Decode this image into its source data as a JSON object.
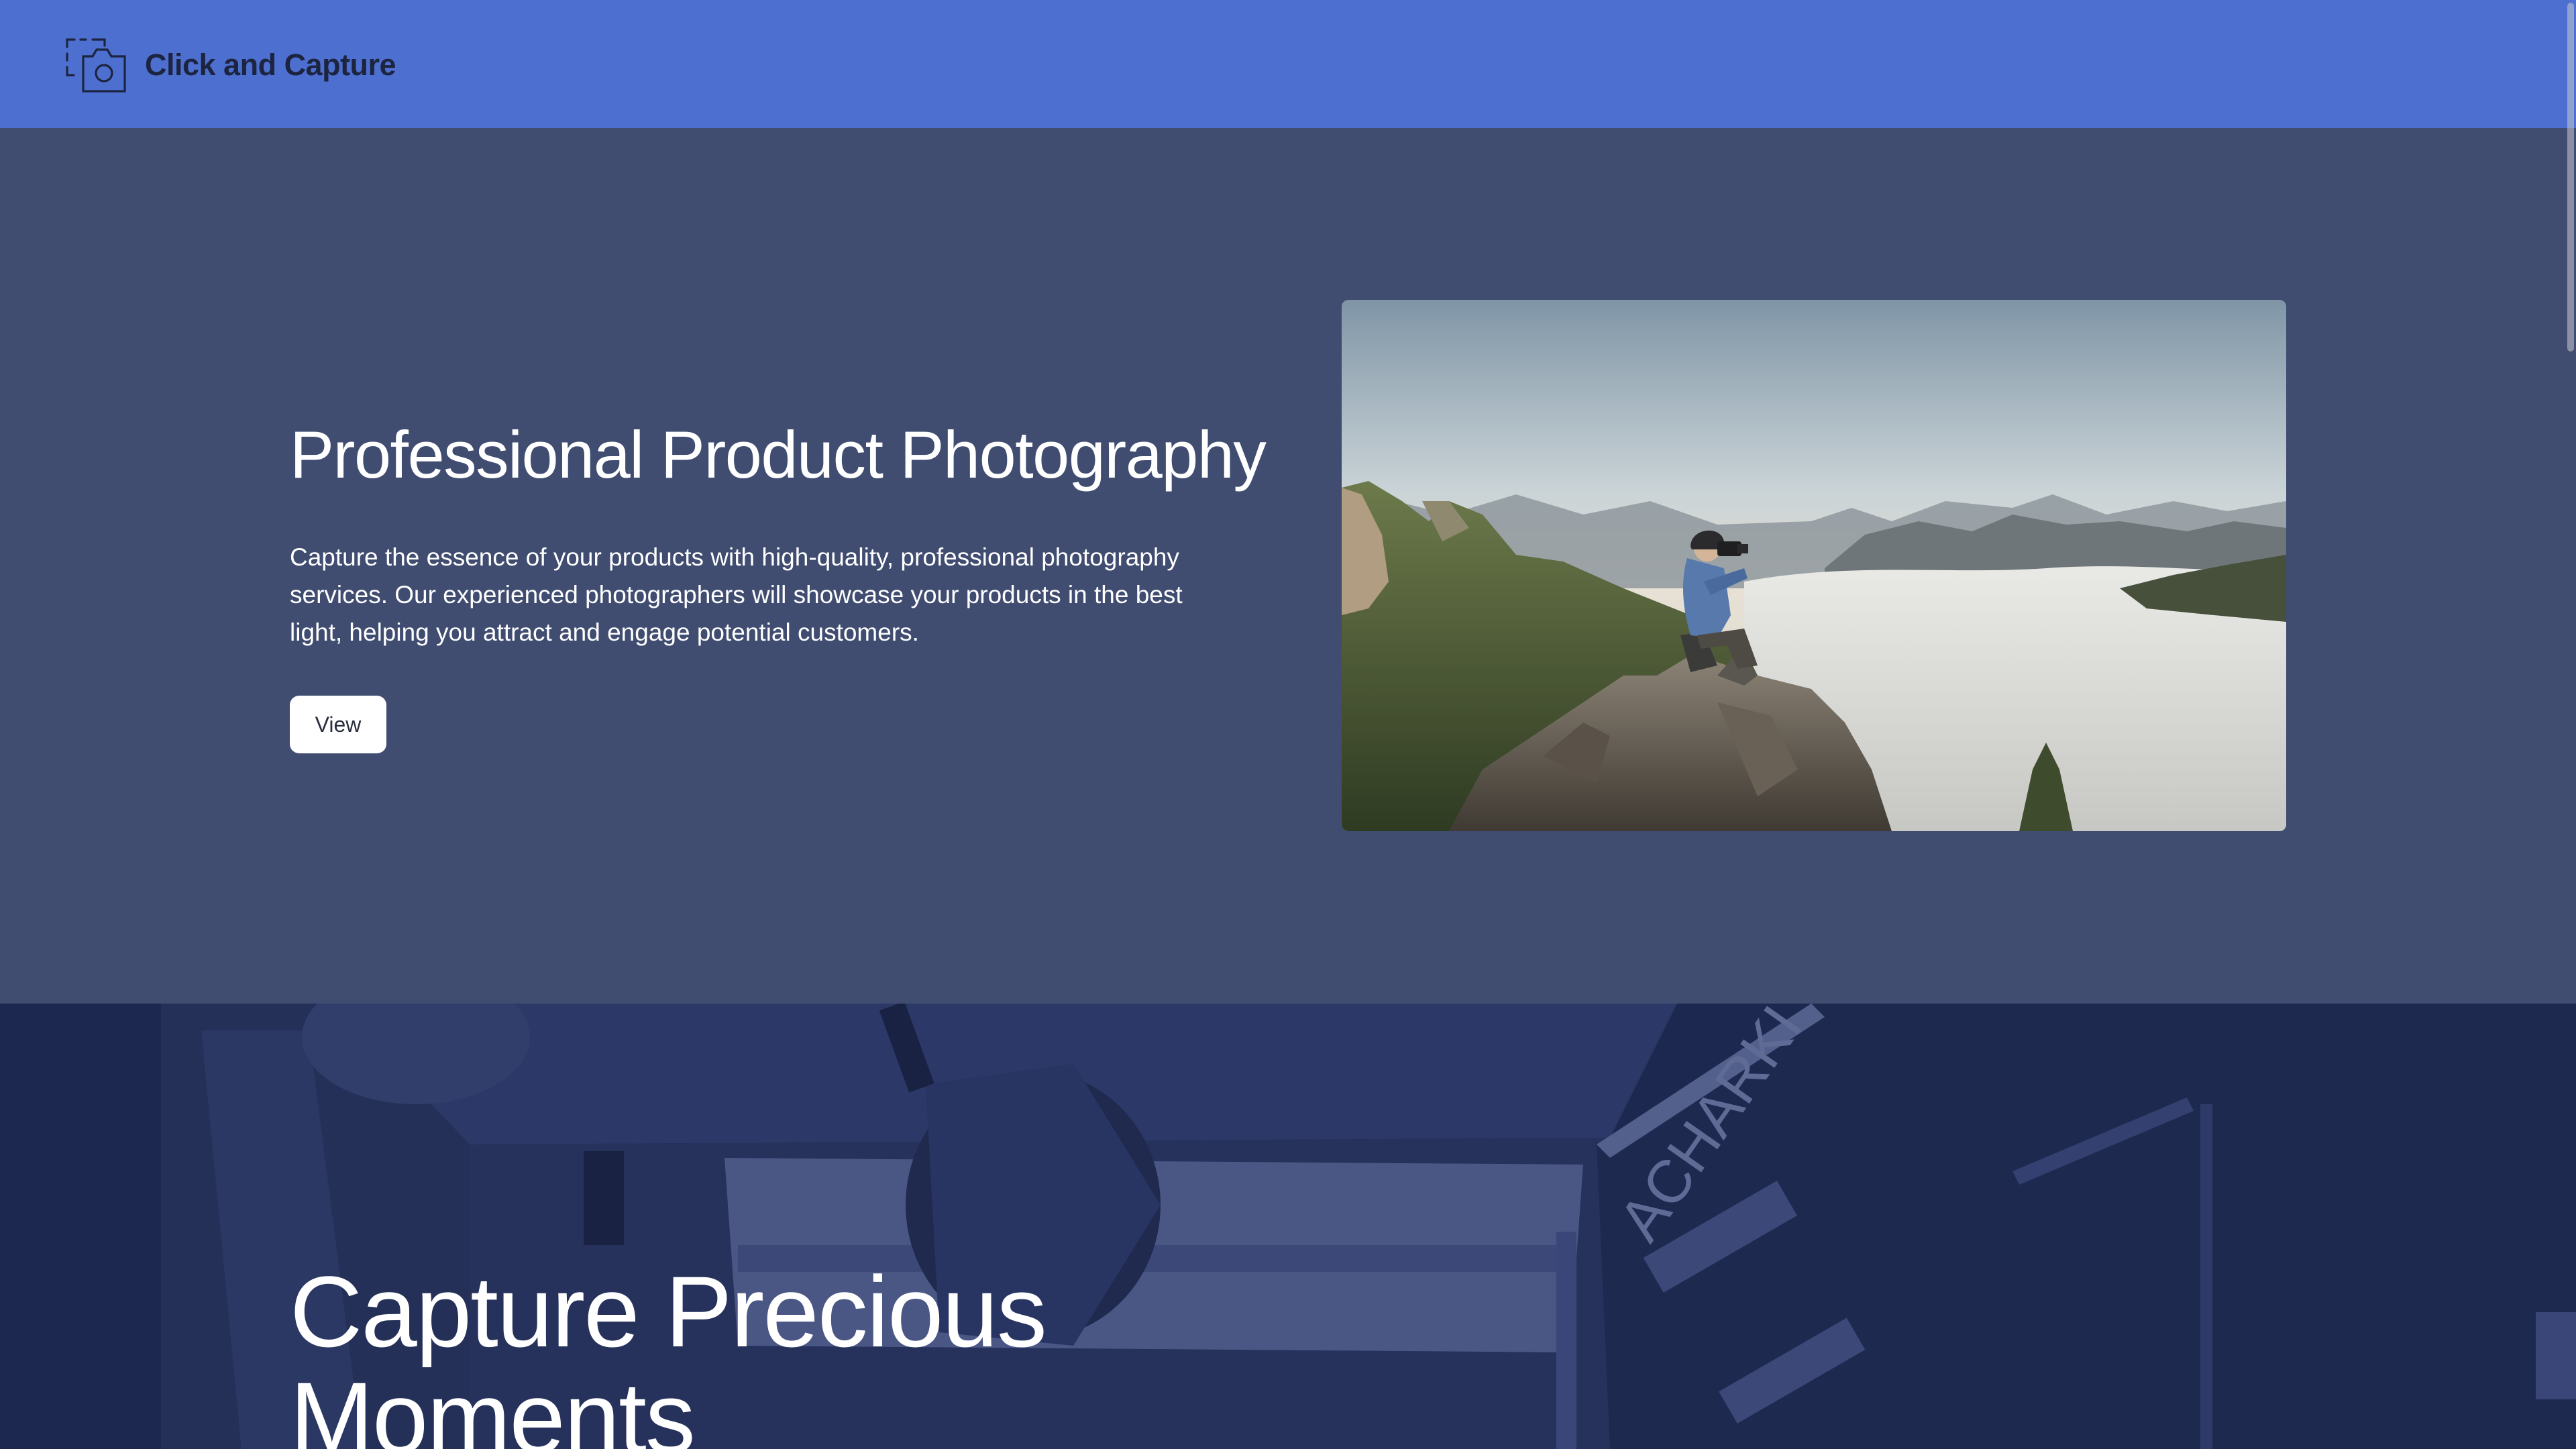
{
  "header": {
    "brand_title": "Click and Capture",
    "brand_icon": "camera-capture-icon",
    "background_color": "#4d6fcf"
  },
  "hero": {
    "title": "Professional Product Photography",
    "description": "Capture the essence of your products with high-quality, professional photography services. Our experienced photographers will showcase your products in the best light, helping you attract and engage potential customers.",
    "button_label": "View",
    "image": "photographer-on-mountain-image",
    "background_color": "#404d71"
  },
  "studio": {
    "title": "Capture Precious Moments",
    "image": "photo-studio-background-image",
    "background_color": "#1d2850"
  }
}
